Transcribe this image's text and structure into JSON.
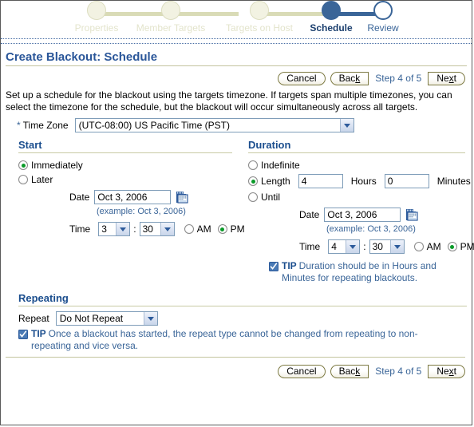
{
  "train": {
    "steps": [
      {
        "label": "Properties",
        "state": "inactive"
      },
      {
        "label": "Member Targets",
        "state": "inactive"
      },
      {
        "label": "Targets on Host",
        "state": "inactive"
      },
      {
        "label": "Schedule",
        "state": "current"
      },
      {
        "label": "Review",
        "state": "upcoming"
      }
    ]
  },
  "header": {
    "title": "Create Blackout: Schedule"
  },
  "toolbar": {
    "cancel_label": "Cancel",
    "back_label": "Back",
    "back_label_pre": "Bac",
    "back_label_key": "k",
    "step_text": "Step 4 of 5",
    "next_label": "Next",
    "next_label_pre": "Ne",
    "next_label_key": "x",
    "next_label_post": "t"
  },
  "intro": {
    "text": "Set up a schedule for the blackout using the targets timezone. If targets span multiple timezones, you can select the timezone for the schedule, but the blackout will occur simultaneously across all targets."
  },
  "timezone": {
    "required_marker": "*",
    "label": "Time Zone",
    "value": "(UTC-08:00) US Pacific Time (PST)",
    "options": [
      "(UTC-08:00) US Pacific Time (PST)"
    ]
  },
  "start": {
    "heading": "Start",
    "immediately_label": "Immediately",
    "immediately_selected": true,
    "later_label": "Later",
    "later_selected": false,
    "date_label": "Date",
    "date_value": "Oct 3, 2006",
    "date_example": "(example: Oct 3, 2006)",
    "time_label": "Time",
    "hour_value": "3",
    "minute_value": "30",
    "separator": ":",
    "am_label": "AM",
    "pm_label": "PM",
    "meridiem_selected": "PM",
    "calendar_icon": "calendar-icon"
  },
  "duration": {
    "heading": "Duration",
    "indefinite_label": "Indefinite",
    "indefinite_selected": false,
    "length_label": "Length",
    "length_selected": true,
    "hours_value": "4",
    "hours_label": "Hours",
    "minutes_value": "0",
    "minutes_label": "Minutes",
    "until_label": "Until",
    "until_selected": false,
    "date_label": "Date",
    "date_value": "Oct 3, 2006",
    "date_example": "(example: Oct 3, 2006)",
    "time_label": "Time",
    "hour_value": "4",
    "minute_value": "30",
    "separator": ":",
    "am_label": "AM",
    "pm_label": "PM",
    "meridiem_selected": "PM",
    "calendar_icon": "calendar-icon",
    "tip_word": "TIP",
    "tip_text": "Duration should be in Hours and Minutes for repeating blackouts."
  },
  "repeating": {
    "heading": "Repeating",
    "repeat_label": "Repeat",
    "repeat_value": "Do Not Repeat",
    "repeat_options": [
      "Do Not Repeat"
    ],
    "tip_word": "TIP",
    "tip_text": "Once a blackout has started, the repeat type cannot be changed from repeating to non-repeating and vice versa."
  },
  "colors": {
    "accent_blue": "#3a6598",
    "title_blue": "#2a5699",
    "train_active": "#3a6598",
    "train_inactive": "#d9dbb6",
    "rule_khaki": "#c3c49e",
    "radio_dot_green": "#0a9a28"
  }
}
